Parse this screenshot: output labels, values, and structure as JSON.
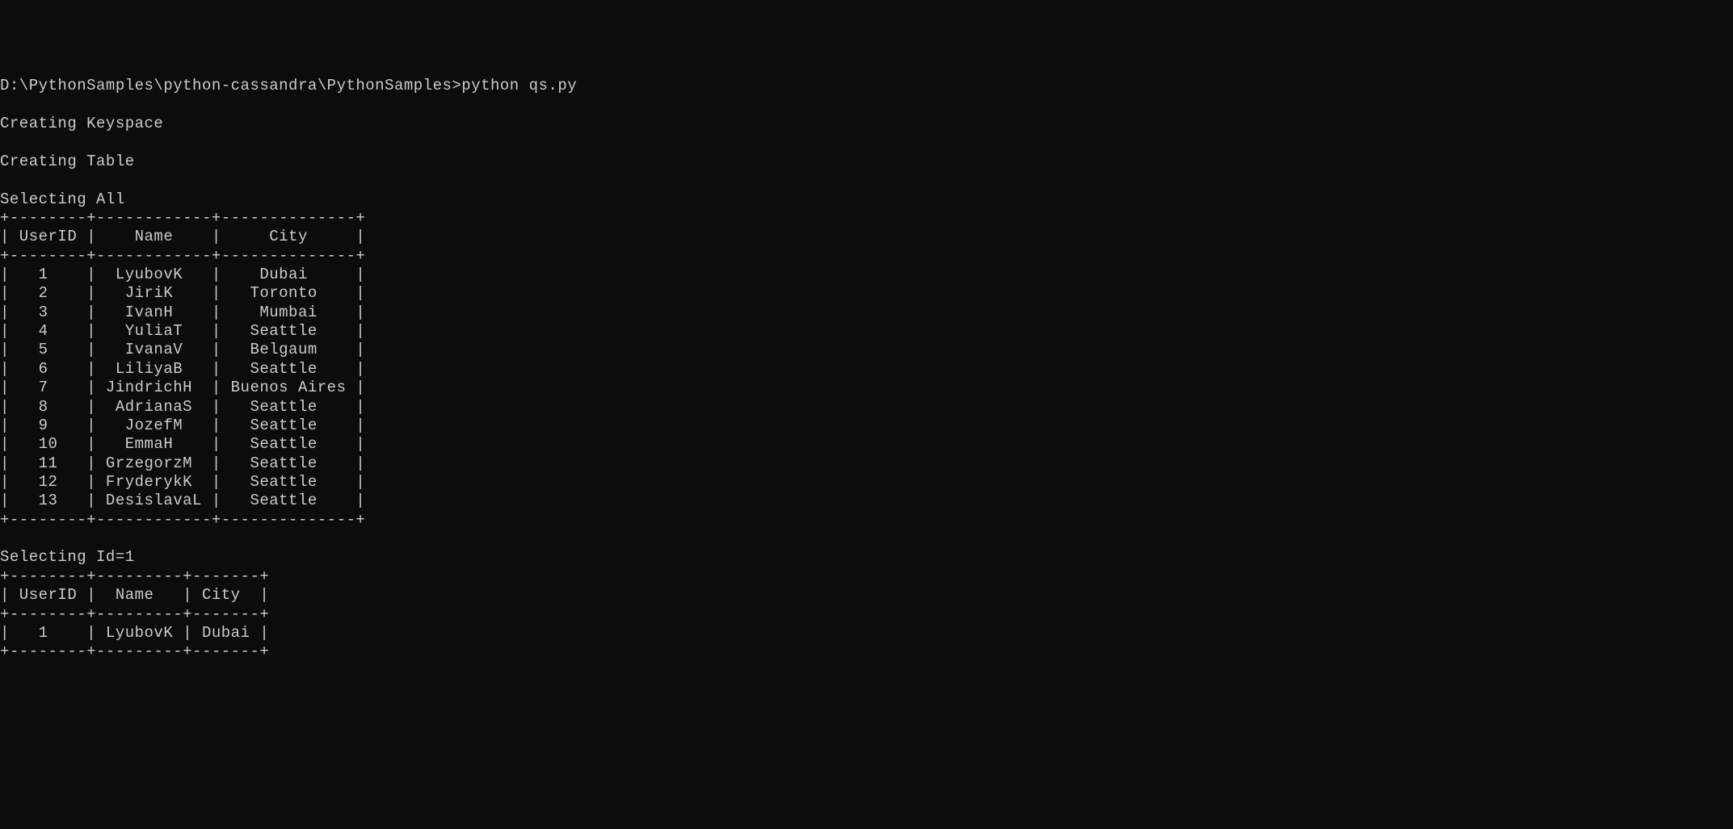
{
  "prompt": {
    "path": "D:\\PythonSamples\\python-cassandra\\PythonSamples>",
    "command": "python qs.py"
  },
  "messages": {
    "creating_keyspace": "Creating Keyspace",
    "creating_table": "Creating Table",
    "selecting_all": "Selecting All",
    "selecting_id1": "Selecting Id=1"
  },
  "table1": {
    "columns": {
      "col1": {
        "header": "UserID",
        "width": 8
      },
      "col2": {
        "header": "Name",
        "width": 12
      },
      "col3": {
        "header": "City",
        "width": 14
      }
    },
    "rows": [
      {
        "id": "1",
        "name": "LyubovK",
        "city": "Dubai"
      },
      {
        "id": "2",
        "name": "JiriK",
        "city": "Toronto"
      },
      {
        "id": "3",
        "name": "IvanH",
        "city": "Mumbai"
      },
      {
        "id": "4",
        "name": "YuliaT",
        "city": "Seattle"
      },
      {
        "id": "5",
        "name": "IvanaV",
        "city": "Belgaum"
      },
      {
        "id": "6",
        "name": "LiliyaB",
        "city": "Seattle"
      },
      {
        "id": "7",
        "name": "JindrichH",
        "city": "Buenos Aires"
      },
      {
        "id": "8",
        "name": "AdrianaS",
        "city": "Seattle"
      },
      {
        "id": "9",
        "name": "JozefM",
        "city": "Seattle"
      },
      {
        "id": "10",
        "name": "EmmaH",
        "city": "Seattle"
      },
      {
        "id": "11",
        "name": "GrzegorzM",
        "city": "Seattle"
      },
      {
        "id": "12",
        "name": "FryderykK",
        "city": "Seattle"
      },
      {
        "id": "13",
        "name": "DesislavaL",
        "city": "Seattle"
      }
    ]
  },
  "table2": {
    "columns": {
      "col1": {
        "header": "UserID",
        "width": 8
      },
      "col2": {
        "header": "Name",
        "width": 9
      },
      "col3": {
        "header": "City",
        "width": 7
      }
    },
    "rows": [
      {
        "id": "1",
        "name": "LyubovK",
        "city": "Dubai"
      }
    ]
  }
}
